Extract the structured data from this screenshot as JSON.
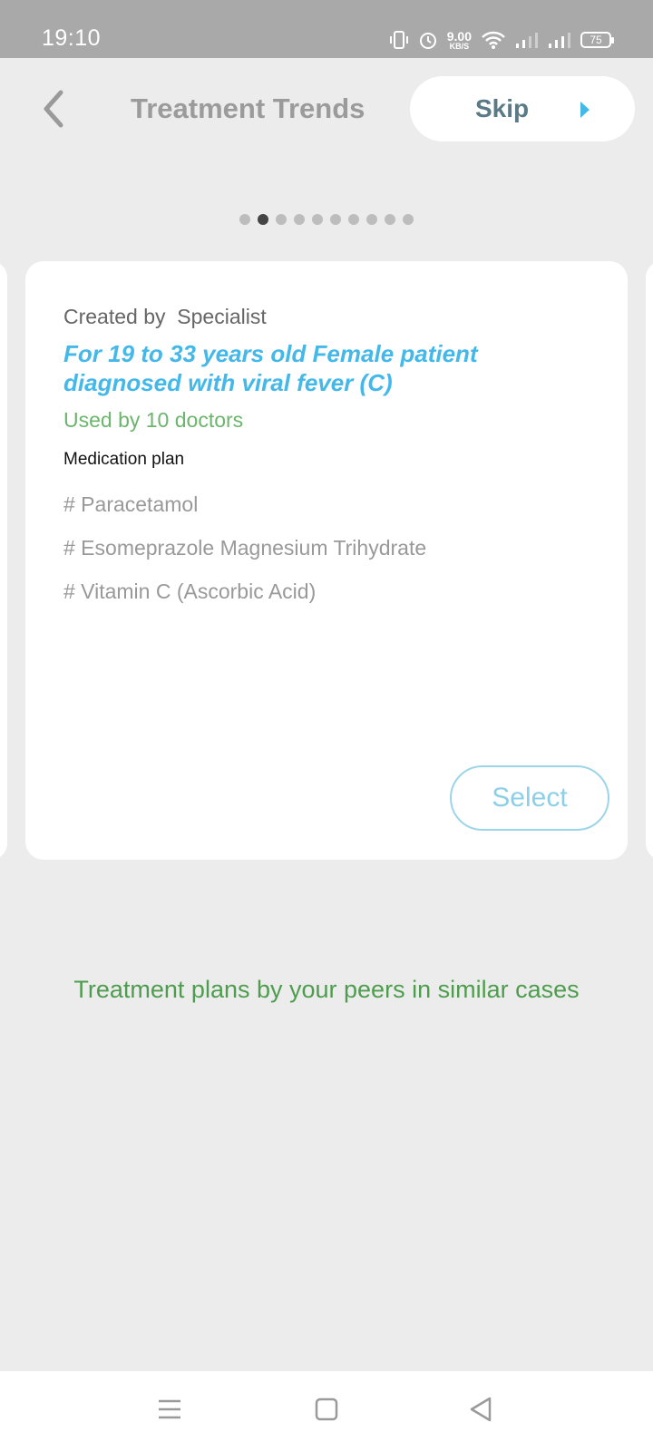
{
  "status_bar": {
    "time": "19:10",
    "net_speed_value": "9.00",
    "net_speed_unit": "KB/S",
    "battery": "75"
  },
  "header": {
    "title": "Treatment Trends",
    "skip_label": "Skip"
  },
  "pagination": {
    "total": 10,
    "active_index": 1
  },
  "card": {
    "created_by": "Created by  Specialist",
    "case_title": "For 19 to 33 years old Female patient diagnosed with viral fever (C)",
    "used_by": "Used by 10 doctors",
    "medication_heading": "Medication plan",
    "medications": [
      "# Paracetamol",
      "# Esomeprazole Magnesium Trihydrate",
      "# Vitamin C (Ascorbic Acid)"
    ],
    "select_label": "Select"
  },
  "caption": "Treatment plans by your peers in similar cases",
  "colors": {
    "accent_blue": "#45b8ea",
    "green": "#6cb56c",
    "status_bar": "#a9a9a9",
    "background": "#ececec"
  },
  "icons": {
    "back": "chevron-left-icon",
    "skip_arrow": "caret-right-icon",
    "nav_menu": "menu-icon",
    "nav_home": "square-home-icon",
    "nav_back": "triangle-back-icon"
  }
}
